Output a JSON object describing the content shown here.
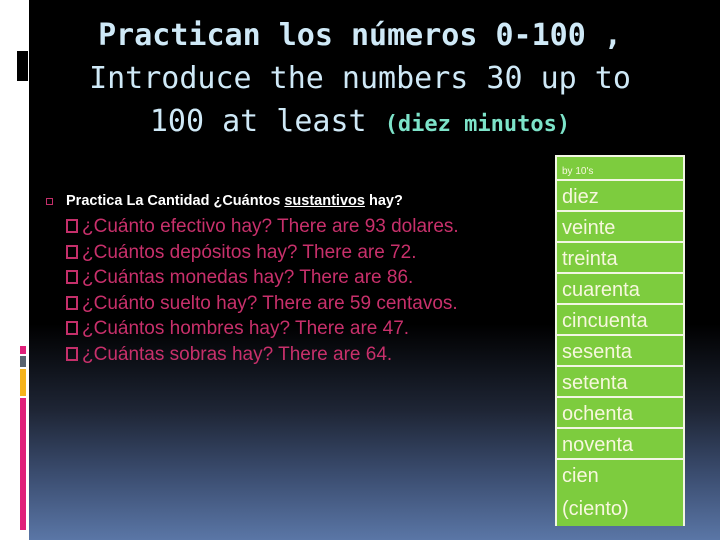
{
  "title": {
    "line1": "Practican  los números 0-100 ,",
    "line2": "Introduce the numbers  30 up to",
    "line3": "100 at least ",
    "subtitle": "(diez minutos)"
  },
  "content": {
    "main_item": {
      "prefix": "Practica La Cantidad ¿Cuántos ",
      "underlined": "sustantivos",
      "suffix": " hay?"
    },
    "sub_items": [
      "¿Cuánto efectivo hay? There are 93 dolares.",
      "¿Cuántos depósitos hay? There are 72.",
      "¿Cuántas monedas hay? There are 86.",
      "¿Cuánto suelto hay? There are 59 centavos.",
      "¿Cuántos hombres hay? There are 47.",
      "¿Cuántas sobras hay? There are 64."
    ]
  },
  "numbers_table": {
    "header": "by 10's",
    "rows": [
      "diez",
      "veinte",
      "treinta",
      "cuarenta",
      "cincuenta",
      "sesenta",
      "setenta",
      "ochenta",
      "noventa"
    ],
    "last_row": [
      "cien",
      "(ciento)"
    ]
  },
  "colors": {
    "title": "#cfe9f7",
    "subtitle": "#7de3c9",
    "sub_item_text": "#c8306b",
    "table_fill": "#7dcc3e",
    "accent_pink": "#e0207a",
    "accent_gray": "#5a6470",
    "accent_yellow": "#f5b31c"
  }
}
